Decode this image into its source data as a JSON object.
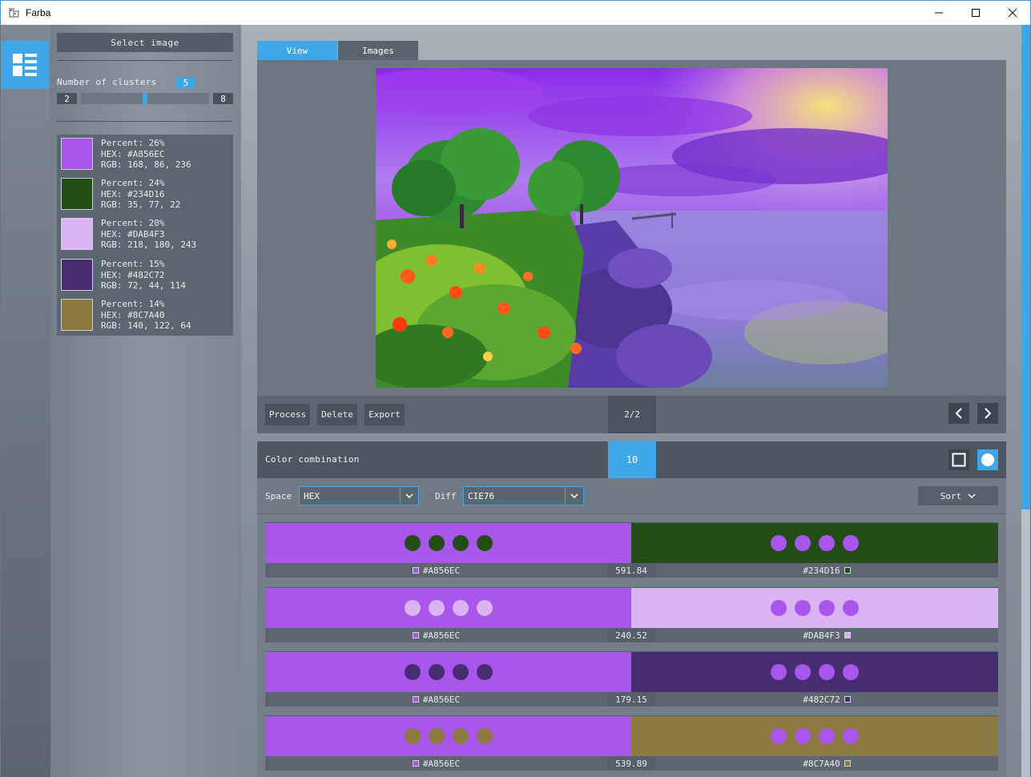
{
  "window": {
    "title": "Farba"
  },
  "left_panel": {
    "select_image_label": "Select image",
    "clusters_label": "Number of clusters",
    "clusters_value": "5",
    "slider_min": "2",
    "slider_max": "8",
    "slider_fraction": 0.5,
    "palette": [
      {
        "percent_line": "Percent: 26%",
        "hex_line": "HEX: #A856EC",
        "rgb_line": "RGB: 168, 86, 236",
        "color": "#A856EC"
      },
      {
        "percent_line": "Percent: 24%",
        "hex_line": "HEX: #234D16",
        "rgb_line": "RGB: 35, 77, 22",
        "color": "#234D16"
      },
      {
        "percent_line": "Percent: 20%",
        "hex_line": "HEX: #DAB4F3",
        "rgb_line": "RGB: 218, 180, 243",
        "color": "#DAB4F3"
      },
      {
        "percent_line": "Percent: 15%",
        "hex_line": "HEX: #482C72",
        "rgb_line": "RGB: 72, 44, 114",
        "color": "#482C72"
      },
      {
        "percent_line": "Percent: 14%",
        "hex_line": "HEX: #8C7A40",
        "rgb_line": "RGB: 140, 122, 64",
        "color": "#8C7A40"
      }
    ]
  },
  "tabs": [
    {
      "label": "View",
      "active": true
    },
    {
      "label": "Images",
      "active": false
    }
  ],
  "toolbar": {
    "process_label": "Process",
    "delete_label": "Delete",
    "export_label": "Export",
    "page_indicator": "2/2"
  },
  "combination": {
    "title": "Color combination",
    "count": "10",
    "space_label": "Space",
    "space_value": "HEX",
    "diff_label": "Diff",
    "diff_value": "CIE76",
    "sort_label": "Sort",
    "pairs": [
      {
        "left_hex": "#A856EC",
        "right_hex": "#234D16",
        "distance": "591.84",
        "left_color": "#A856EC",
        "right_color": "#234D16"
      },
      {
        "left_hex": "#A856EC",
        "right_hex": "#DAB4F3",
        "distance": "240.52",
        "left_color": "#A856EC",
        "right_color": "#DAB4F3"
      },
      {
        "left_hex": "#A856EC",
        "right_hex": "#482C72",
        "distance": "179.15",
        "left_color": "#A856EC",
        "right_color": "#482C72"
      },
      {
        "left_hex": "#A856EC",
        "right_hex": "#8C7A40",
        "distance": "539.89",
        "left_color": "#A856EC",
        "right_color": "#8C7A40"
      }
    ]
  },
  "colors": {
    "accent": "#3FA7E7"
  },
  "icons": {
    "app": "palette-app-icon",
    "rail": "list-view-icon",
    "prev": "chevron-left-icon",
    "next": "chevron-right-icon",
    "square_shape": "square-icon",
    "circle_shape": "circle-icon",
    "dropdown": "chevron-down-icon"
  }
}
